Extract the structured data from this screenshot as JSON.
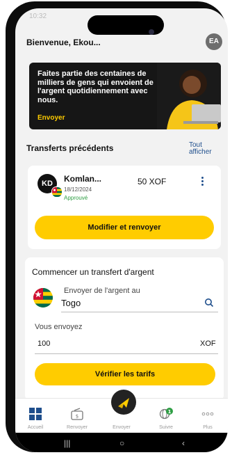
{
  "status_bar": {
    "time": "10:32"
  },
  "header": {
    "welcome": "Bienvenue, Ekou...",
    "avatar_initials": "EA"
  },
  "banner": {
    "text": "Faites partie des centaines de milliers de gens qui envoient de l'argent quotidiennement avec nous.",
    "cta": "Envoyer"
  },
  "previous": {
    "title": "Transferts précédents",
    "see_all": "Tout afficher",
    "item": {
      "initials": "KD",
      "name": "Komlan...",
      "date": "18/12/2024",
      "status": "Approuvé",
      "amount": "50 XOF",
      "button": "Modifier et renvoyer"
    }
  },
  "transfer": {
    "title": "Commencer un transfert d'argent",
    "destination_label": "Envoyer de l'argent au",
    "destination_value": "Togo",
    "send_label": "Vous envoyez",
    "send_value": "100",
    "currency": "XOF",
    "button": "Vérifier les tarifs"
  },
  "nav": {
    "items": [
      {
        "label": "Accueil",
        "icon": "home-grid-icon"
      },
      {
        "label": "Renvoyer",
        "icon": "resend-money-icon"
      },
      {
        "label": "Envoyer",
        "icon": "send-plane-icon"
      },
      {
        "label": "Suivre",
        "icon": "track-globe-icon",
        "badge": "1"
      },
      {
        "label": "Plus",
        "icon": "more-dots-icon"
      }
    ]
  },
  "colors": {
    "accent": "#ffcc00",
    "link": "#1e4e8c",
    "approved": "#2e9e44"
  }
}
